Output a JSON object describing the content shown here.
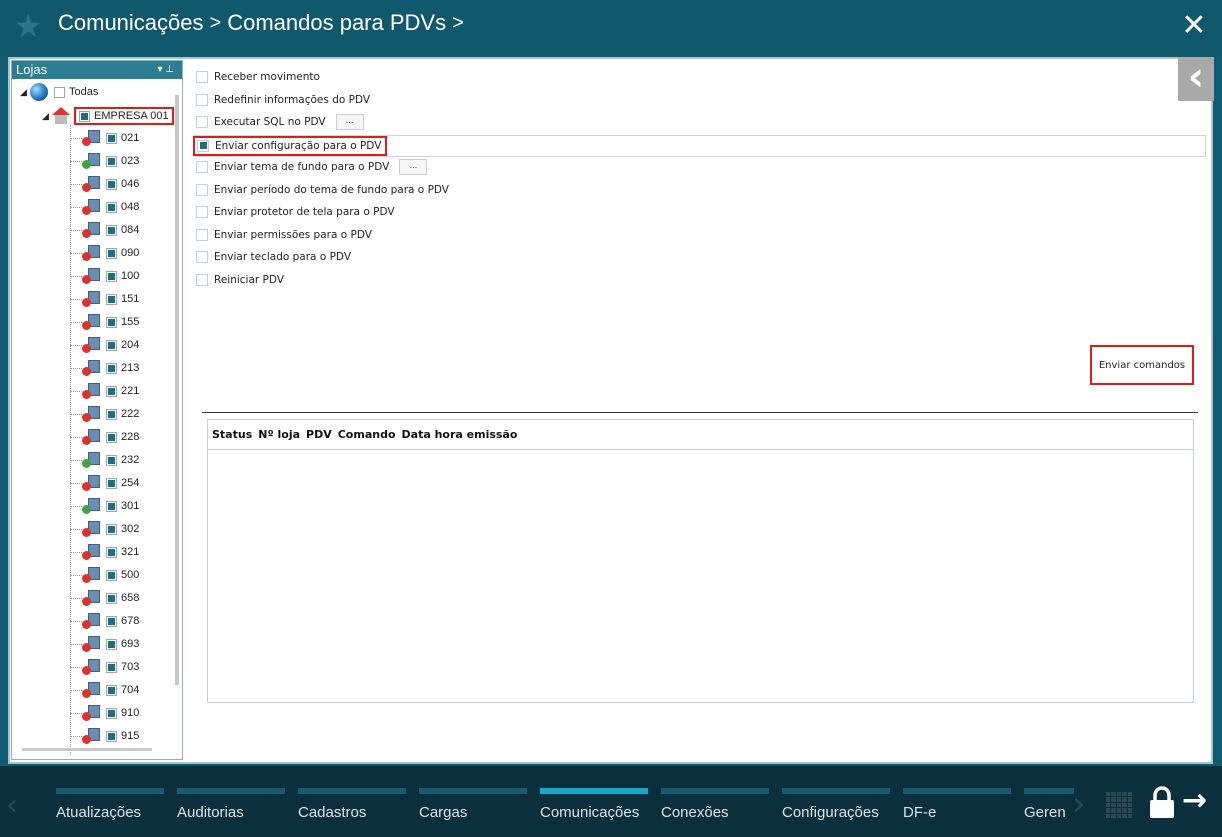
{
  "header": {
    "breadcrumb": [
      "Comunicações",
      "Comandos para PDVs"
    ],
    "separator": ">"
  },
  "tree": {
    "title": "Lojas",
    "root_label": "Todas",
    "company_label": "EMPRESA 001",
    "pdvs": [
      {
        "id": "021",
        "status": "error"
      },
      {
        "id": "023",
        "status": "ok"
      },
      {
        "id": "046",
        "status": "error"
      },
      {
        "id": "048",
        "status": "error"
      },
      {
        "id": "084",
        "status": "error"
      },
      {
        "id": "090",
        "status": "error"
      },
      {
        "id": "100",
        "status": "error"
      },
      {
        "id": "151",
        "status": "error"
      },
      {
        "id": "155",
        "status": "error"
      },
      {
        "id": "204",
        "status": "error"
      },
      {
        "id": "213",
        "status": "error"
      },
      {
        "id": "221",
        "status": "error"
      },
      {
        "id": "222",
        "status": "error"
      },
      {
        "id": "228",
        "status": "error"
      },
      {
        "id": "232",
        "status": "ok"
      },
      {
        "id": "254",
        "status": "error"
      },
      {
        "id": "301",
        "status": "ok"
      },
      {
        "id": "302",
        "status": "error"
      },
      {
        "id": "321",
        "status": "error"
      },
      {
        "id": "500",
        "status": "error"
      },
      {
        "id": "658",
        "status": "error"
      },
      {
        "id": "678",
        "status": "error"
      },
      {
        "id": "693",
        "status": "error"
      },
      {
        "id": "703",
        "status": "error"
      },
      {
        "id": "704",
        "status": "error"
      },
      {
        "id": "910",
        "status": "error"
      },
      {
        "id": "915",
        "status": "error"
      }
    ]
  },
  "commands": {
    "items": [
      {
        "label": "Receber movimento",
        "has_button": false,
        "checked": false
      },
      {
        "label": "Redefinir informações do PDV",
        "has_button": false,
        "checked": false
      },
      {
        "label": "Executar SQL no PDV",
        "has_button": true,
        "checked": false
      },
      {
        "label": "Enviar configuração para o PDV",
        "has_button": false,
        "checked": true
      },
      {
        "label": "Enviar tema de fundo para o PDV",
        "has_button": true,
        "checked": false
      },
      {
        "label": "Enviar período do tema de fundo para o PDV",
        "has_button": false,
        "checked": false
      },
      {
        "label": "Enviar protetor de tela para o PDV",
        "has_button": false,
        "checked": false
      },
      {
        "label": "Enviar permissões para o PDV",
        "has_button": false,
        "checked": false
      },
      {
        "label": "Enviar teclado para o PDV",
        "has_button": false,
        "checked": false
      },
      {
        "label": "Reiniciar PDV",
        "has_button": false,
        "checked": false
      }
    ],
    "ellipsis_label": "...",
    "send_label": "Enviar comandos"
  },
  "grid": {
    "columns": [
      "Status",
      "Nº loja",
      "PDV",
      "Comando",
      "Data hora emissão"
    ]
  },
  "bottom_nav": {
    "items": [
      {
        "label": "Atualizações",
        "active": false
      },
      {
        "label": "Auditorias",
        "active": false
      },
      {
        "label": "Cadastros",
        "active": false
      },
      {
        "label": "Cargas",
        "active": false
      },
      {
        "label": "Comunicações",
        "active": true
      },
      {
        "label": "Conexões",
        "active": false
      },
      {
        "label": "Configurações",
        "active": false
      },
      {
        "label": "DF-e",
        "active": false
      },
      {
        "label": "Geren",
        "active": false
      }
    ]
  },
  "colors": {
    "header_bg": "#10596c",
    "accent": "#18a7c4",
    "highlight": "#e01b1b"
  }
}
